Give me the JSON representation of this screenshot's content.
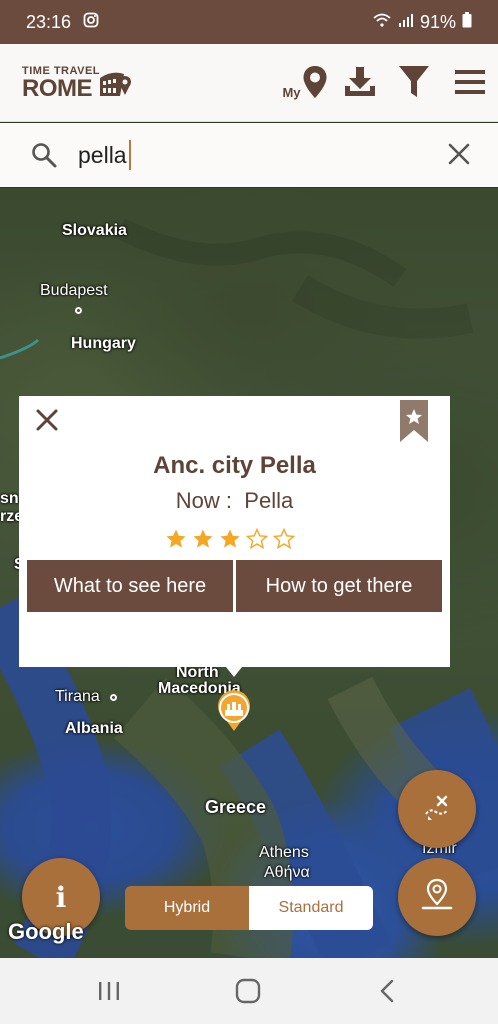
{
  "status_bar": {
    "time": "23:16",
    "battery": "91%",
    "icons": [
      "instagram-icon",
      "wifi-icon",
      "signal-icon",
      "battery-icon"
    ]
  },
  "header": {
    "logo_top": "TIME TRAVEL",
    "logo_bottom": "ROME",
    "my_label": "My",
    "icons": [
      "my-location-pin-icon",
      "download-icon",
      "filter-icon",
      "menu-icon"
    ]
  },
  "search": {
    "value": "pella",
    "icons": [
      "search-icon",
      "clear-icon"
    ]
  },
  "map": {
    "labels": {
      "slovakia": "Slovakia",
      "budapest": "Budapest",
      "hungary": "Hungary",
      "north": "North",
      "macedonia": "Macedonia",
      "tirana": "Tirana",
      "albania": "Albania",
      "greece": "Greece",
      "athens": "Athens",
      "athens_greek": "Αθήνα",
      "izmir": "İzmir",
      "edge_sn": "sn",
      "edge_rze": "rze",
      "edge_s": "S"
    },
    "attribution": "Google",
    "toggle": {
      "hybrid": "Hybrid",
      "standard": "Standard",
      "selected": "Hybrid"
    }
  },
  "popup": {
    "title": "Anc. city Pella",
    "now_label": "Now :",
    "now_value": "Pella",
    "rating": 3,
    "rating_max": 5,
    "btn_see": "What to see here",
    "btn_get": "How to get there"
  },
  "fabs": {
    "info": "i"
  },
  "colors": {
    "brand_brown": "#6b4b3e",
    "accent_ochre": "#a9703b",
    "star_gold": "#f5a623"
  }
}
